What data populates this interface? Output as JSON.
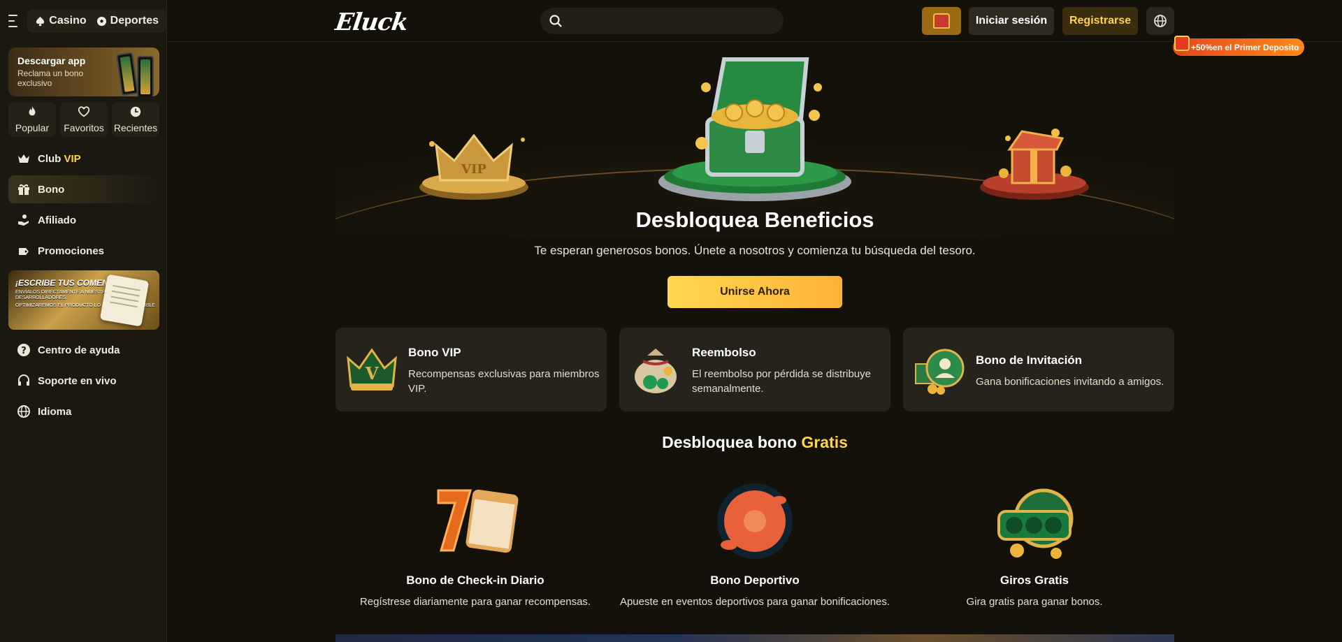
{
  "header": {
    "nav_tabs": [
      {
        "label": "Casino",
        "icon": "spade-icon"
      },
      {
        "label": "Deportes",
        "icon": "soccer-ball-icon"
      }
    ],
    "logo": "Eluck",
    "search": {
      "placeholder": "",
      "value": ""
    },
    "login_label": "Iniciar sesión",
    "register_label": "Registrarse",
    "deposit_badge": "+50%en el Primer Deposito"
  },
  "sidebar": {
    "app_promo": {
      "title": "Descargar app",
      "subtitle": "Reclama un bono exclusivo"
    },
    "quick": [
      {
        "label": "Popular",
        "icon": "flame-icon"
      },
      {
        "label": "Favoritos",
        "icon": "heart-icon"
      },
      {
        "label": "Recientes",
        "icon": "clock-icon"
      }
    ],
    "club": {
      "prefix": "Club",
      "vip": "VIP"
    },
    "items_top": [
      {
        "label": "Bono",
        "icon": "gift-icon",
        "active": true
      },
      {
        "label": "Afiliado",
        "icon": "affiliate-icon"
      },
      {
        "label": "Promociones",
        "icon": "promotions-icon"
      }
    ],
    "feedback_banner": {
      "title": "¡ESCRIBE TUS COMENTARIOS!",
      "line1": "ENVÍALOS DIRECTAMENTE A NUESTROS DESARROLLADORES.",
      "line2": "OPTIMIZAREMOS EL PRODUCTO LO MÁS RÁPIDO POSIBLE"
    },
    "items_bottom": [
      {
        "label": "Centro de ayuda",
        "icon": "help-icon"
      },
      {
        "label": "Soporte en vivo",
        "icon": "headset-icon"
      },
      {
        "label": "Idioma",
        "icon": "globe-icon"
      }
    ]
  },
  "hero": {
    "title": "Desbloquea Beneficios",
    "subtitle": "Te esperan generosos bonos. Únete a nosotros y comienza tu búsqueda del tesoro.",
    "cta": "Unirse Ahora"
  },
  "benefits": [
    {
      "title": "Bono VIP",
      "desc": "Recompensas exclusivas para miembros VIP."
    },
    {
      "title": "Reembolso",
      "desc": "El reembolso por pérdida se distribuye semanalmente."
    },
    {
      "title": "Bono de Invitación",
      "desc": "Gana bonificaciones invitando a amigos."
    }
  ],
  "free_section": {
    "title_prefix": "Desbloquea bono",
    "title_highlight": "Gratis",
    "items": [
      {
        "title": "Bono de Check-in Diario",
        "desc": "Regístrese diariamente para ganar recompensas."
      },
      {
        "title": "Bono Deportivo",
        "desc": "Apueste en eventos deportivos para ganar bonificaciones."
      },
      {
        "title": "Giros Gratis",
        "desc": "Gira gratis para ganar bonos."
      }
    ]
  },
  "colors": {
    "accent": "#ffd44a",
    "background": "#131109",
    "sidebar": "#1b1810",
    "card": "#26231c"
  }
}
